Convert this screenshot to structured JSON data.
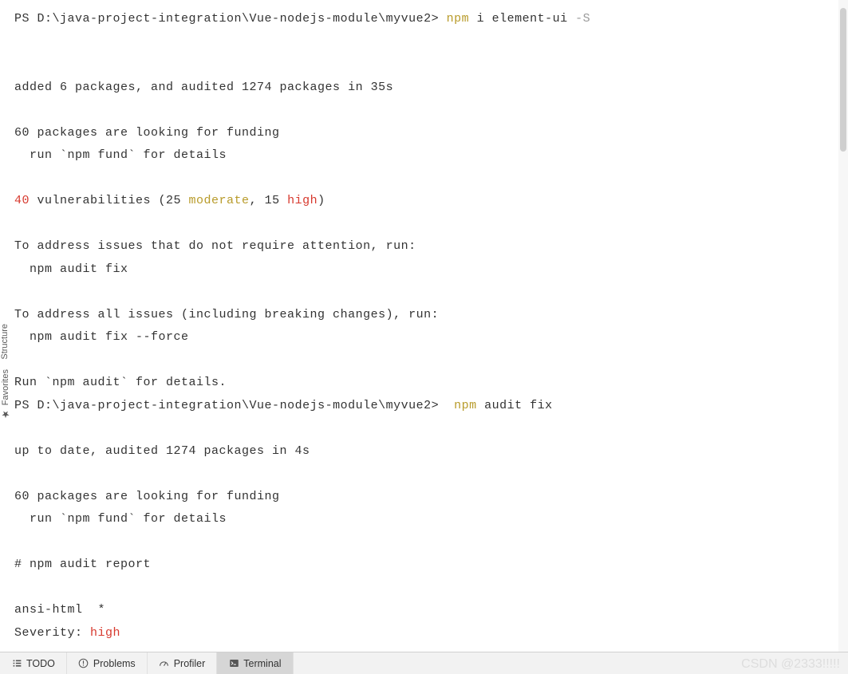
{
  "prompt1": {
    "ps": "PS ",
    "path": "D:\\java-project-integration\\Vue-nodejs-module\\myvue2> ",
    "cmd_tool": "npm",
    "cmd_rest": " i element-ui ",
    "cmd_flag": "-S"
  },
  "output1": {
    "l1": "added 6 packages, and audited 1274 packages in 35s",
    "l2": "60 packages are looking for funding",
    "l3": "  run `npm fund` for details",
    "vuln_count": "40",
    "vuln_text1": " vulnerabilities (25 ",
    "vuln_moderate": "moderate",
    "vuln_text2": ", 15 ",
    "vuln_high": "high",
    "vuln_text3": ")",
    "l4": "To address issues that do not require attention, run:",
    "l5": "  npm audit fix",
    "l6": "To address all issues (including breaking changes), run:",
    "l7": "  npm audit fix --force",
    "l8": "Run `npm audit` for details."
  },
  "prompt2": {
    "ps": "PS ",
    "path": "D:\\java-project-integration\\Vue-nodejs-module\\myvue2>  ",
    "cmd_tool": "npm",
    "cmd_rest": " audit fix"
  },
  "output2": {
    "l1": "up to date, audited 1274 packages in 4s",
    "l2": "60 packages are looking for funding",
    "l3": "  run `npm fund` for details",
    "l4": "# npm audit report",
    "l5": "ansi-html  *",
    "sev_label": "Severity: ",
    "sev_value": "high"
  },
  "tabs": {
    "todo": "TODO",
    "problems": "Problems",
    "profiler": "Profiler",
    "terminal": "Terminal"
  },
  "sidebar": {
    "structure": "Structure",
    "favorites": "Favorites"
  },
  "watermark": "CSDN @2333!!!!!"
}
